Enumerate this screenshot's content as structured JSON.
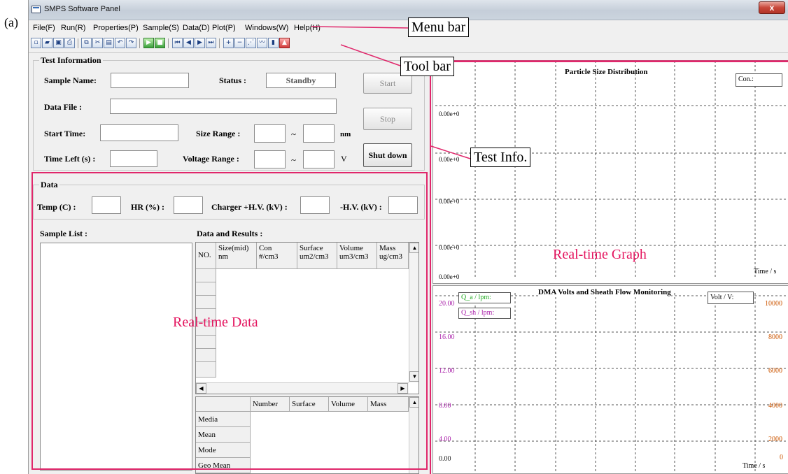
{
  "figure_label": "(a)",
  "window": {
    "title": "SMPS Software Panel",
    "close_glyph": "x"
  },
  "menu": [
    "File(F)",
    "Run(R)",
    "Properties(P)",
    "Sample(S)",
    "Data(D)",
    "Plot(P)",
    "Windows(W)",
    "Help(H)"
  ],
  "toolbar": [
    "new-file-icon",
    "open-folder-icon",
    "save-icon",
    "print-icon",
    "copy-icon",
    "cut-icon",
    "paste-icon",
    "undo-icon",
    "redo-icon",
    "run-icon",
    "stop-icon",
    "first-icon",
    "prev-icon",
    "next-icon",
    "last-icon",
    "zoom-in-icon",
    "zoom-out-icon",
    "scatter-plot-icon",
    "line-plot-icon",
    "bar-chart-icon",
    "area-chart-icon"
  ],
  "test_info": {
    "group_title": "Test Information",
    "sample_name_label": "Sample Name:",
    "status_label": "Status :",
    "status_value": "Standby",
    "data_file_label": "Data File :",
    "start_time_label": "Start Time:",
    "size_range_label": "Size Range :",
    "tilde": "~",
    "size_unit": "nm",
    "time_left_label": "Time Left (s) :",
    "voltage_range_label": "Voltage Range :",
    "voltage_unit": "V",
    "start_button": "Start",
    "stop_button": "Stop",
    "shutdown_button": "Shut down"
  },
  "data_group": {
    "group_title": "Data",
    "temp_label": "Temp (C) :",
    "hr_label": "HR (%) :",
    "charger_label": "Charger +H.V. (kV) :",
    "hv_label": "-H.V. (kV) :"
  },
  "sample_list_label": "Sample List :",
  "results": {
    "label": "Data and Results :",
    "columns": [
      {
        "line1": "NO.",
        "line2": ""
      },
      {
        "line1": "Size(mid)",
        "line2": "nm"
      },
      {
        "line1": "Con",
        "line2": "#/cm3"
      },
      {
        "line1": "Surface",
        "line2": "um2/cm3"
      },
      {
        "line1": "Volume",
        "line2": "um3/cm3"
      },
      {
        "line1": "Mass",
        "line2": "ug/cm3"
      }
    ],
    "stats_columns": [
      "Number",
      "Surface",
      "Volume",
      "Mass"
    ],
    "stats_rows": [
      "Media",
      "Mean",
      "Mode",
      "Geo Mean"
    ]
  },
  "graph1": {
    "title": "Particle Size Distribution",
    "legend": "Con.:",
    "y_ticks": [
      "0.00e+0",
      "0.00e+0",
      "0.00e+0",
      "0.00e+0",
      "0.00e+0"
    ],
    "x_label": "Time / s"
  },
  "graph2": {
    "title": "DMA Volts and Sheath Flow Monitoring",
    "legend_qa": "Q_a / lpm:",
    "legend_qsh": "Q_sh / lpm:",
    "legend_volt": "Volt / V:",
    "y_left_ticks": [
      "20.00",
      "16.00",
      "12.00",
      "8.00",
      "4.00",
      "0.00"
    ],
    "y_right_ticks": [
      "10000",
      "8000",
      "6000",
      "4000",
      "2000",
      "0"
    ],
    "x_label": "Time / s",
    "colors": {
      "qa": "#22aa22",
      "qsh": "#aa22aa",
      "volt_axis": "#cc5500"
    }
  },
  "annotations": {
    "menu_bar": "Menu bar",
    "tool_bar": "Tool bar",
    "test_info": "Test Info.",
    "realtime_graph": "Real-time  Graph",
    "realtime_data": "Real-time  Data"
  }
}
